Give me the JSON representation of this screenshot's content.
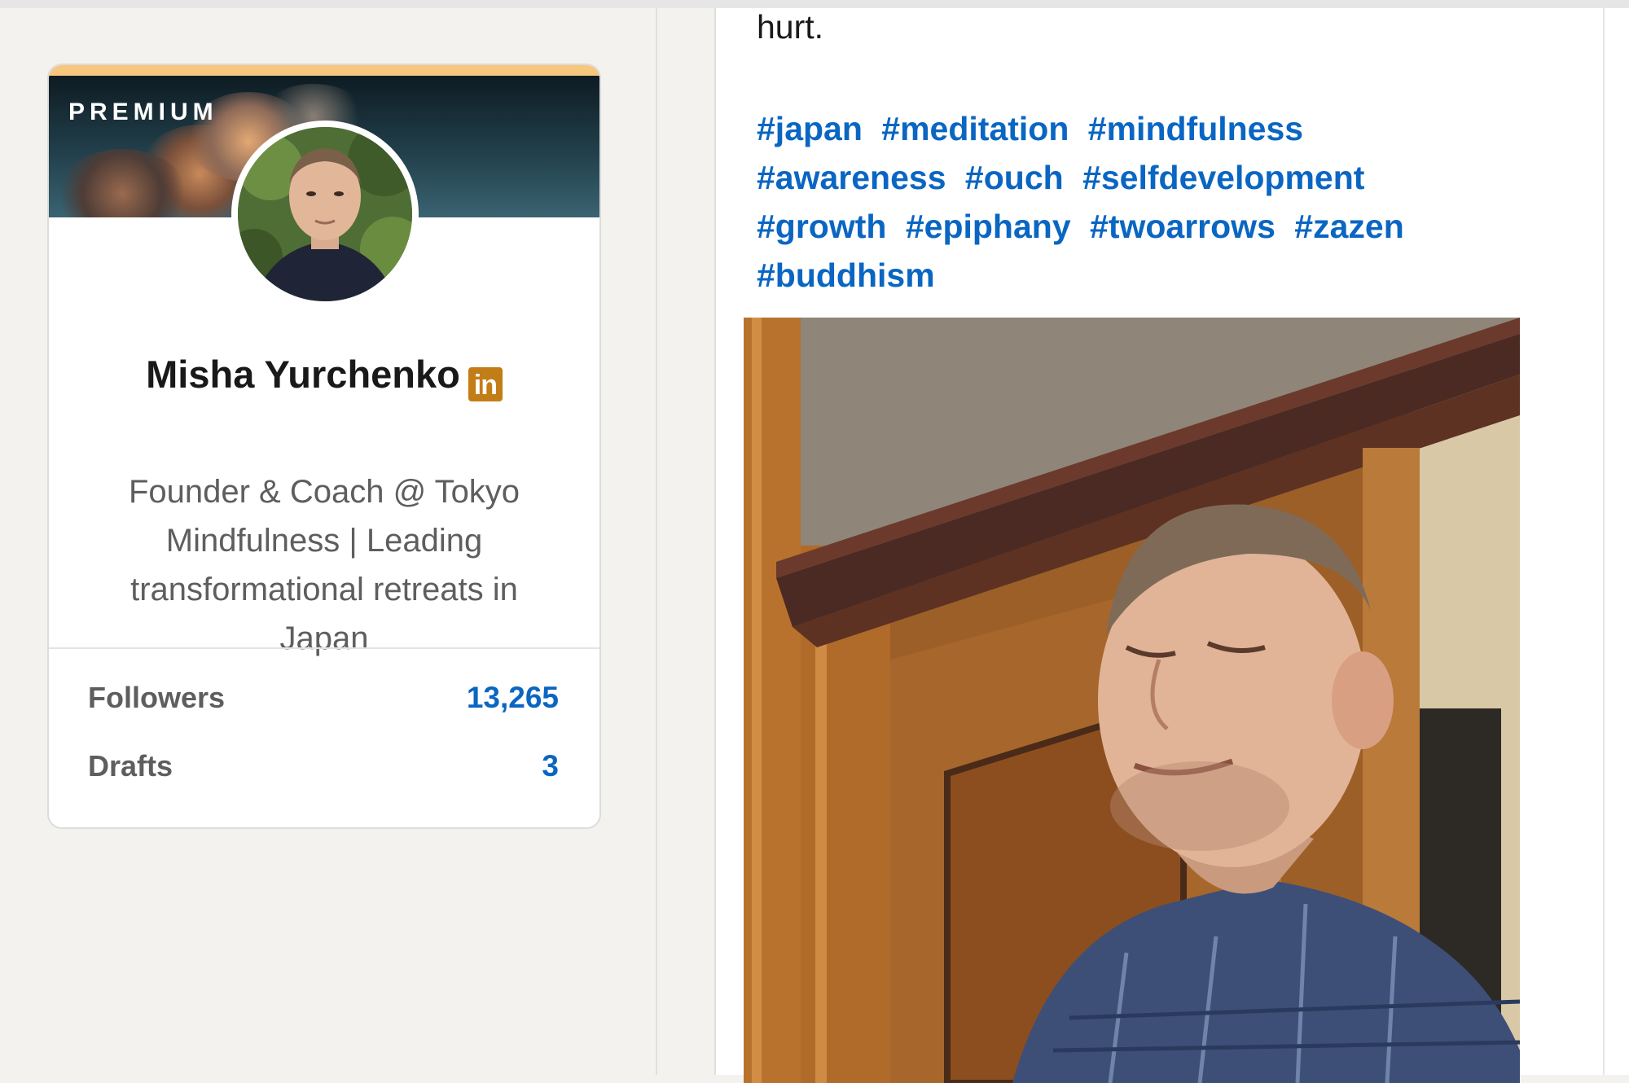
{
  "profile": {
    "badge": "PREMIUM",
    "name": "Misha Yurchenko",
    "linkedin_badge": "in",
    "headline": "Founder & Coach @ Tokyo Mindfulness | Leading transformational retreats in Japan",
    "stats": [
      {
        "label": "Followers",
        "value": "13,265"
      },
      {
        "label": "Drafts",
        "value": "3"
      }
    ]
  },
  "post": {
    "text_tail": "hurt.",
    "hashtags": [
      "#japan",
      "#meditation",
      "#mindfulness",
      "#awareness",
      "#ouch",
      "#selfdevelopment",
      "#growth",
      "#epiphany",
      "#twoarrows",
      "#zazen",
      "#buddhism"
    ]
  },
  "colors": {
    "link_blue": "#0a66c2",
    "premium_gold": "#c37d16",
    "premium_accent": "#f8c77e"
  }
}
